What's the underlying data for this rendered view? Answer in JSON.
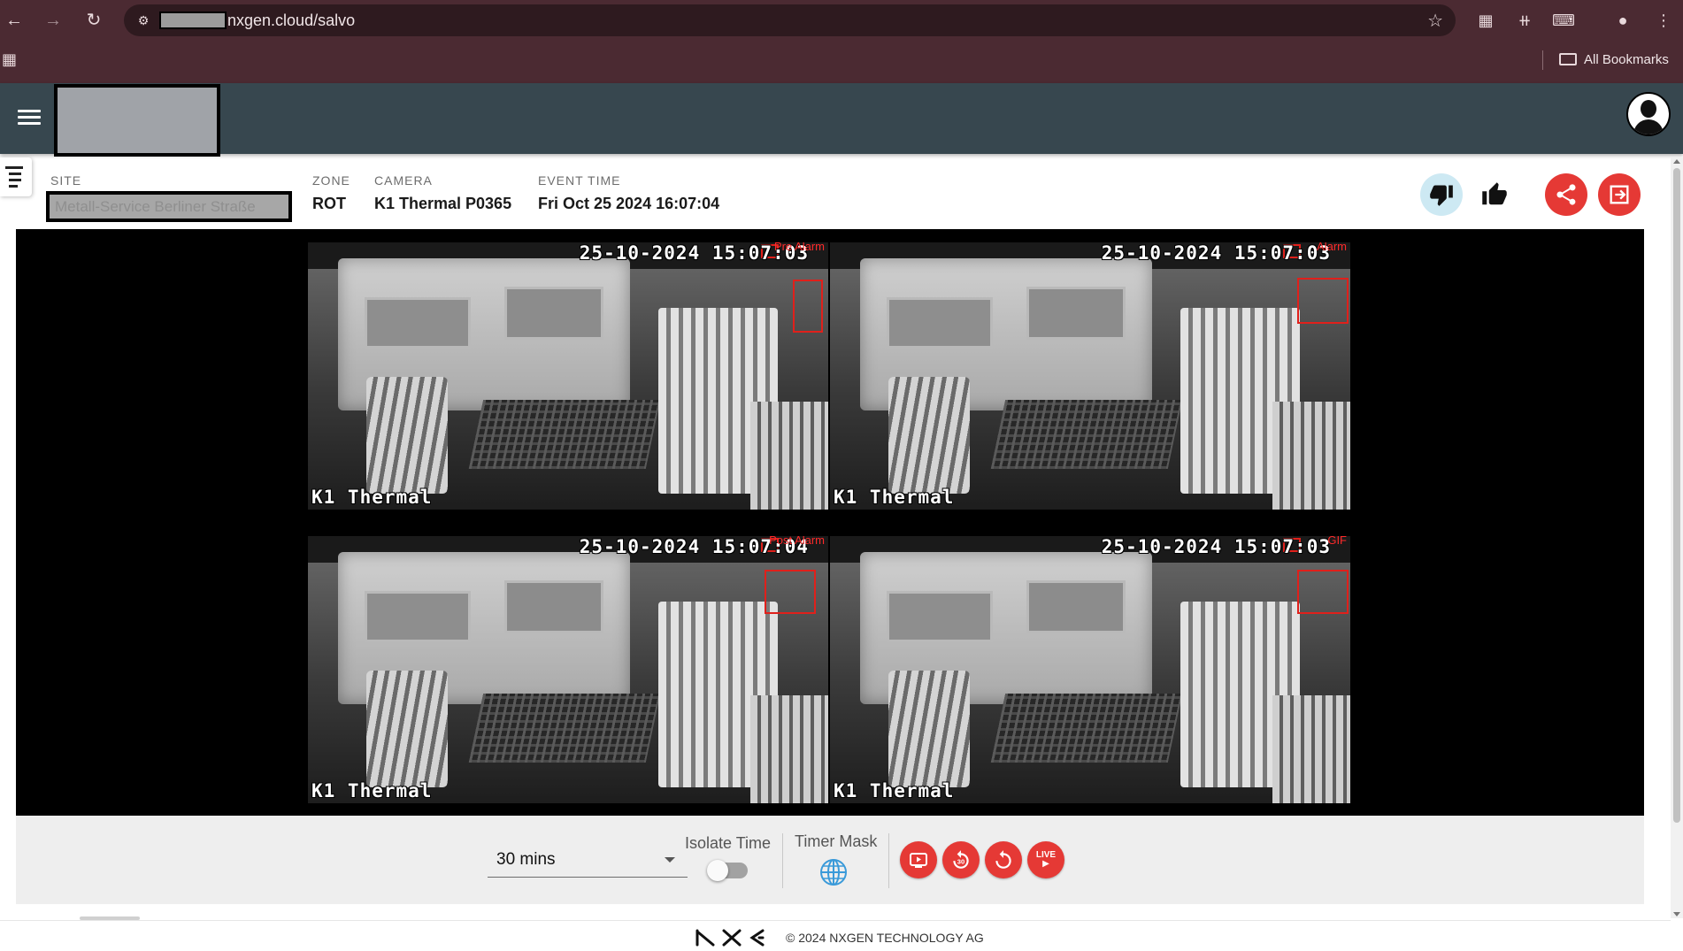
{
  "browser": {
    "url": "nxgen.cloud/salvo",
    "bookmarks_label": "All Bookmarks"
  },
  "event": {
    "site_label": "SITE",
    "site_value": "Metall-Service Berliner Straße",
    "zone_label": "ZONE",
    "zone_value": "ROT",
    "camera_label": "CAMERA",
    "camera_value": "K1 Thermal P0365",
    "event_time_label": "EVENT TIME",
    "event_time_value": "Fri Oct 25 2024 16:07:04"
  },
  "tiles": [
    {
      "tag": "Pre Alarm",
      "timestamp": "25-10-2024 15:07:03",
      "camera_overlay": "K1 Thermal"
    },
    {
      "tag": "Alarm",
      "timestamp": "25-10-2024 15:07:03",
      "camera_overlay": "K1 Thermal"
    },
    {
      "tag": "Post Alarm",
      "timestamp": "25-10-2024 15:07:04",
      "camera_overlay": "K1 Thermal"
    },
    {
      "tag": "GIF",
      "timestamp": "25-10-2024 15:07:03",
      "camera_overlay": "K1 Thermal"
    }
  ],
  "controls": {
    "duration_value": "30 mins",
    "isolate_time_label": "Isolate Time",
    "isolate_time_on": false,
    "timer_mask_label": "Timer Mask",
    "live_label": "LIVE"
  },
  "footer": {
    "copyright": "© 2024 NXGEN TECHNOLOGY AG"
  },
  "colors": {
    "browser_frame": "#4b2a32",
    "app_header": "#37474f",
    "accent_red": "#e53935",
    "bbox_red": "#e0201b",
    "thumbdown_bg": "#cde9f3"
  },
  "icons": {
    "back": "arrow-left-icon",
    "forward": "arrow-right-icon",
    "reload": "reload-icon",
    "site_info": "tune-icon",
    "bookmark": "star-icon",
    "thumb_down": "thumb-down-icon",
    "thumb_up": "thumb-up-icon",
    "share": "share-icon",
    "exit": "exit-icon",
    "globe": "globe-icon"
  }
}
